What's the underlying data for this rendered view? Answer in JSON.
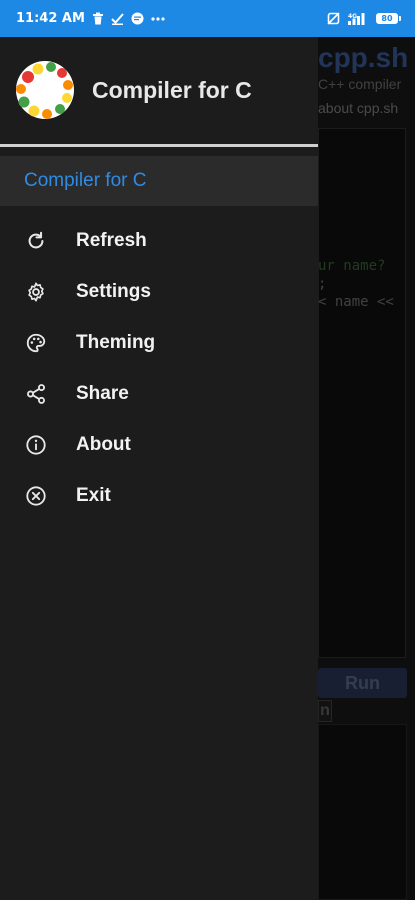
{
  "status_bar": {
    "time": "11:42 AM",
    "battery_level": "80",
    "icons": [
      "trash-icon",
      "checkmark-icon",
      "chat-icon",
      "more-dots-icon",
      "screen-rotate-icon",
      "signal-icon",
      "battery-icon"
    ]
  },
  "background_app": {
    "title": "cpp.sh",
    "subtitle": "C++ compiler",
    "about_link": "about cpp.sh",
    "code_lines": [
      "ur name?",
      ";",
      "< name <<"
    ],
    "run_button": "Run",
    "tab_label": "n"
  },
  "drawer": {
    "app_name": "Compiler for C",
    "selected_item": "Compiler for C",
    "menu": [
      {
        "label": "Refresh",
        "icon": "refresh-icon"
      },
      {
        "label": "Settings",
        "icon": "gear-icon"
      },
      {
        "label": "Theming",
        "icon": "palette-icon"
      },
      {
        "label": "Share",
        "icon": "share-icon"
      },
      {
        "label": "About",
        "icon": "info-icon"
      },
      {
        "label": "Exit",
        "icon": "close-circle-icon"
      }
    ]
  },
  "colors": {
    "status_bar": "#1e88e5",
    "drawer_bg": "#1c1c1c",
    "selected_text": "#2f8be3",
    "selected_bg": "#2b2b2b"
  }
}
